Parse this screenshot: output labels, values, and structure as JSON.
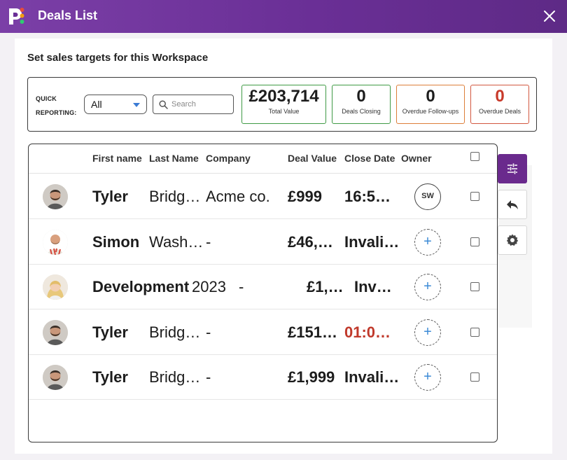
{
  "window": {
    "title": "Deals List"
  },
  "section_title": "Set sales targets for this Workspace",
  "quick_reporting": {
    "label_line1": "QUICK",
    "label_line2": "REPORTING:",
    "filter_value": "All",
    "search_placeholder": "Search"
  },
  "stats": [
    {
      "value": "£203,714",
      "label": "Total Value",
      "accent": "#3f9a45"
    },
    {
      "value": "0",
      "label": "Deals Closing",
      "accent": "#3f9a45"
    },
    {
      "value": "0",
      "label": "Overdue Follow-ups",
      "accent": "#dd7e3a"
    },
    {
      "value": "0",
      "label": "Overdue Deals",
      "accent": "#d2573f"
    }
  ],
  "table": {
    "columns": [
      "First name",
      "Last Name",
      "Company",
      "Deal Value",
      "Close Date",
      "Owner"
    ],
    "rows": [
      {
        "first": "Tyler",
        "last": "Bridg…",
        "company": "Acme co.",
        "value": "£999",
        "close": "16:5…",
        "owner": "SW",
        "avatar": "male-beard"
      },
      {
        "first": "Simon",
        "last": "Wash…",
        "company": "-",
        "value": "£46,…",
        "close": "Invali…",
        "owner": "+",
        "avatar": "male-bald"
      },
      {
        "first": "Development",
        "last": "2023",
        "company": "-",
        "value": "£1,…",
        "close": "Inv…",
        "owner": "+",
        "avatar": "female-blonde"
      },
      {
        "first": "Tyler",
        "last": "Bridg…",
        "company": "-",
        "value": "£151…",
        "close": "01:0…",
        "owner": "+",
        "avatar": "male-beard",
        "close_color": "#c0392b"
      },
      {
        "first": "Tyler",
        "last": "Bridg…",
        "company": "-",
        "value": "£1,999",
        "close": "Invali…",
        "owner": "+",
        "avatar": "male-beard"
      }
    ]
  },
  "colors": {
    "brand": "#6a2f96",
    "accent_blue": "#3b7bd4",
    "overdue_red": "#c0392b"
  },
  "sidebar": [
    "filter-icon",
    "reply-icon",
    "gear-icon"
  ]
}
